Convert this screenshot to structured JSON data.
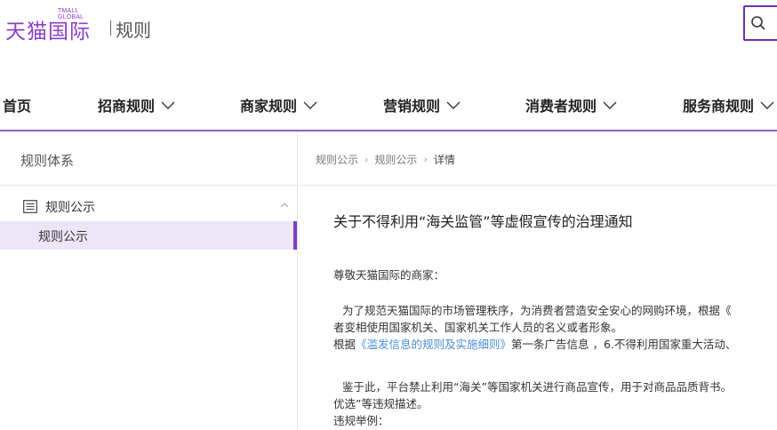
{
  "header": {
    "logo_small": "TMALL GLOBAL",
    "logo_main": "天猫国际",
    "logo_sub": "规则",
    "search_icon": "search-icon"
  },
  "nav": {
    "items": [
      {
        "label": "首页"
      },
      {
        "label": "招商规则"
      },
      {
        "label": "商家规则"
      },
      {
        "label": "营销规则"
      },
      {
        "label": "消费者规则"
      },
      {
        "label": "服务商规则"
      }
    ]
  },
  "sidebar": {
    "title": "规则体系",
    "group_label": "规则公示",
    "sub_item_label": "规则公示"
  },
  "breadcrumb": {
    "items": [
      "规则公示",
      "规则公示",
      "详情"
    ]
  },
  "article": {
    "title": "关于不得利用“海关监管”等虚假宣传的治理通知",
    "greeting": "尊敬天猫国际的商家：",
    "p1_line1": "为了规范天猫国际的市场管理秩序，为消费者营造安全安心的网购环境，根据《",
    "p1_line2": "者变相使用国家机关、国家机关工作人员的名义或者形象。",
    "p1_line3_prefix": "根据",
    "p1_line3_link": "《滥发信息的规则及实施细则》",
    "p1_line3_suffix": "第一条广告信息 ，6.不得利用国家重大活动、",
    "p2_line1": "鉴于此，平台禁止利用“海关”等国家机关进行商品宣传，用于对商品品质背书。",
    "p2_line2": "优选”等违规描述。",
    "p3": "违规举例："
  },
  "colors": {
    "brand": "#8b3fc7",
    "accent": "#7b3fc8",
    "link": "#4a8fd6",
    "active_bg": "#ede6f7"
  }
}
